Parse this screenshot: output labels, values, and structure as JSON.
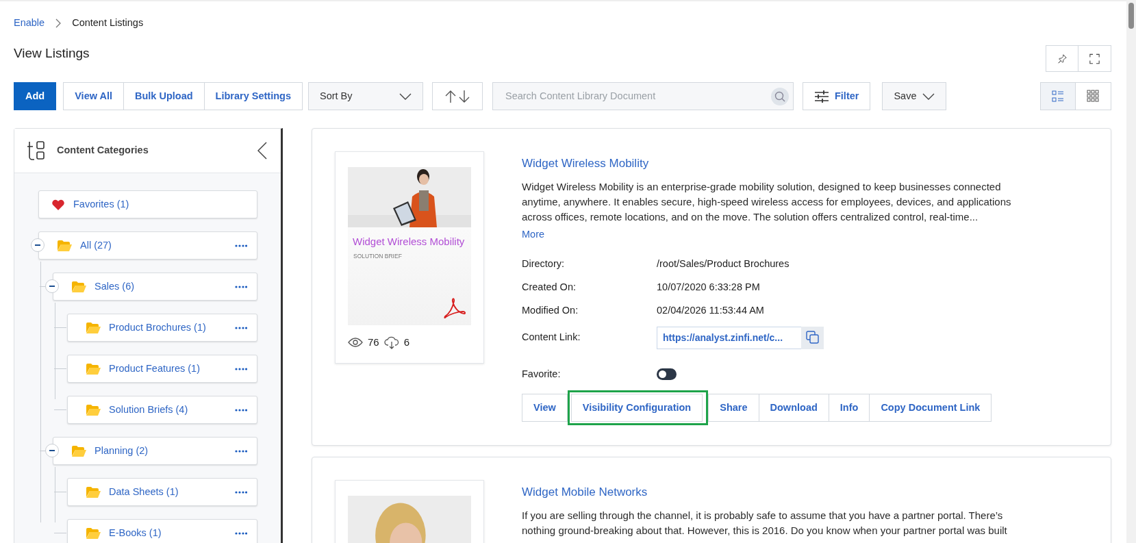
{
  "breadcrumb": [
    {
      "label": "Enable",
      "link": true
    },
    {
      "label": "Content Listings",
      "link": false
    }
  ],
  "page_title": "View Listings",
  "toolbar": {
    "buttons": [
      {
        "label": "Add",
        "primary": true
      },
      {
        "label": "View All",
        "primary": false
      },
      {
        "label": "Bulk Upload",
        "primary": false
      },
      {
        "label": "Library Settings",
        "primary": false
      }
    ],
    "sort": {
      "label": "Sort By"
    },
    "search": {
      "placeholder": "Search Content Library Document"
    },
    "filter": {
      "label": "Filter"
    },
    "save": {
      "label": "Save"
    },
    "views": [
      {
        "kind": "list",
        "selected": true
      },
      {
        "kind": "grid",
        "selected": false
      }
    ]
  },
  "sidebar": {
    "title": "Content Categories",
    "items": [
      {
        "kind": "favorites",
        "label": "Favorites (1)"
      },
      {
        "kind": "folder",
        "label": "All (27)",
        "expanded": true,
        "children": [
          {
            "kind": "folder",
            "label": "Sales (6)",
            "expanded": true,
            "children": [
              {
                "kind": "folder",
                "label": "Product Brochures (1)"
              },
              {
                "kind": "folder",
                "label": "Product Features (1)"
              },
              {
                "kind": "folder",
                "label": "Solution Briefs (4)"
              }
            ]
          },
          {
            "kind": "folder",
            "label": "Planning (2)",
            "expanded": true,
            "children": [
              {
                "kind": "folder",
                "label": "Data Sheets (1)"
              },
              {
                "kind": "folder",
                "label": "E-Books (1)"
              }
            ]
          }
        ]
      }
    ]
  },
  "listings": [
    {
      "title": "Widget Wireless Mobility",
      "thumbnail": {
        "title": "Widget Wireless Mobility",
        "subtitle": "SOLUTION BRIEF"
      },
      "views": "76",
      "downloads": "6",
      "description": "Widget Wireless Mobility is an enterprise-grade mobility solution, designed to keep businesses connected anytime, anywhere. It enables secure, high-speed wireless access for employees, devices, and applications across offices, remote locations, and on the move. The solution offers centralized control, real-time...",
      "more": "More",
      "details": [
        {
          "label": "Directory:",
          "value": "/root/Sales/Product Brochures"
        },
        {
          "label": "Created On:",
          "value": "10/07/2020 6:33:28 PM"
        },
        {
          "label": "Modified On:",
          "value": "02/04/2026 11:53:44 AM"
        }
      ],
      "content_link": {
        "label": "Content Link:",
        "value": "https://analyst.zinfi.net/c..."
      },
      "favorite": {
        "label": "Favorite:",
        "on": false
      },
      "actions": [
        {
          "label": "View",
          "highlighted": false
        },
        {
          "label": "Visibility Configuration",
          "highlighted": true
        },
        {
          "label": "Share",
          "highlighted": false
        },
        {
          "label": "Download",
          "highlighted": false
        },
        {
          "label": "Info",
          "highlighted": false
        },
        {
          "label": "Copy Document Link",
          "highlighted": false
        }
      ]
    },
    {
      "title": "Widget Mobile Networks",
      "description": "If you are selling through the channel, it is probably safe to assume that you have a partner portal. There’s nothing ground-breaking about that. However, this is 2016. Do you know when your partner portal was built"
    }
  ]
}
